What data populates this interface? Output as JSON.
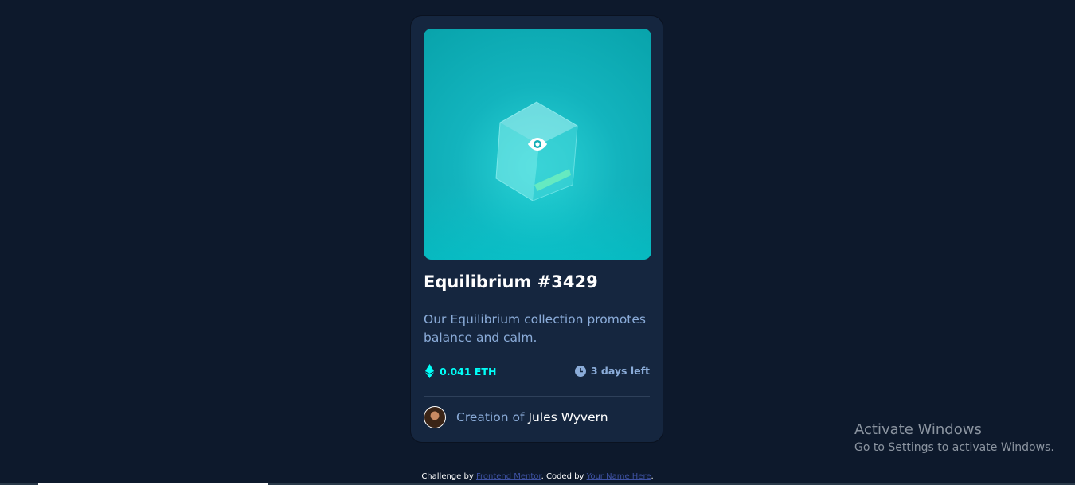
{
  "card": {
    "image_alt": "equilibrium cube",
    "title": "Equilibrium #3429",
    "description": "Our Equilibrium collection promotes balance and calm.",
    "price": "0.041 ETH",
    "time_left": "3 days left",
    "creator_prefix": "Creation of",
    "creator_name": "Jules Wyvern"
  },
  "attribution": {
    "challenge_prefix": "Challenge by",
    "challenge_link": "Frontend Mentor",
    "coded_prefix": ". Coded by",
    "coded_link": "Your Name Here",
    "suffix": "."
  },
  "watermark": {
    "title": "Activate Windows",
    "subtitle": "Go to Settings to activate Windows."
  },
  "colors": {
    "page_bg": "#0d192c",
    "card_bg": "#15263f",
    "cyan": "#00fff8",
    "soft_blue": "#8bacd9",
    "white": "#ffffff"
  },
  "icons": {
    "view": "eye-icon",
    "price": "ethereum-icon",
    "time": "clock-icon"
  }
}
